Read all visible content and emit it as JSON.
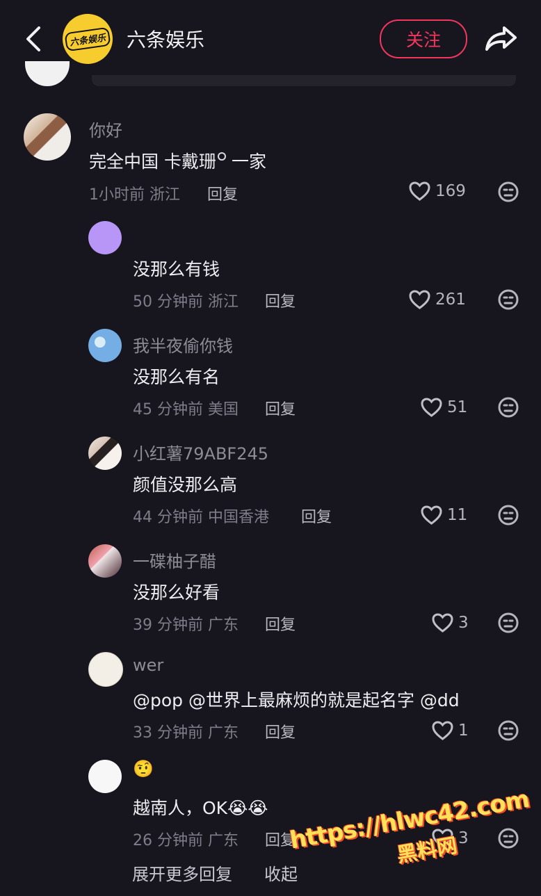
{
  "header": {
    "account_name": "六条娱乐",
    "logo_text": "六条娱乐",
    "follow_label": "关注"
  },
  "comments": [
    {
      "author": "你好",
      "text_prefix": "完全中国",
      "mention": "卡戴珊",
      "text_suffix": "一家",
      "time_location": "1小时前 浙江",
      "reply": "回复",
      "likes": "169"
    },
    {
      "author": "",
      "text": "没那么有钱",
      "time_location": "50 分钟前 浙江",
      "reply": "回复",
      "likes": "261"
    },
    {
      "author": "我半夜偷你钱",
      "text": "没那么有名",
      "time_location": "45 分钟前 美国",
      "reply": "回复",
      "likes": "51"
    },
    {
      "author": "小红薯79ABF245",
      "text": "颜值没那么高",
      "time_location": "44 分钟前 中国香港",
      "reply": "回复",
      "likes": "11"
    },
    {
      "author": "一碟柚子醋",
      "text": "没那么好看",
      "time_location": "39 分钟前 广东",
      "reply": "回复",
      "likes": "3"
    },
    {
      "author": "wer",
      "text": "@pop @世界上最麻烦的就是起名字 @dd",
      "time_location": "33 分钟前 广东",
      "reply": "回复",
      "likes": "1"
    },
    {
      "author": "🤨",
      "text": "越南人，OK😭😭",
      "time_location": "26 分钟前 广东",
      "reply": "回复",
      "likes": "3"
    }
  ],
  "footer": {
    "expand_label": "展开更多回复",
    "collapse_label": "收起"
  },
  "watermark": {
    "url": "https://hlwc42.com",
    "site": "黑料网"
  }
}
